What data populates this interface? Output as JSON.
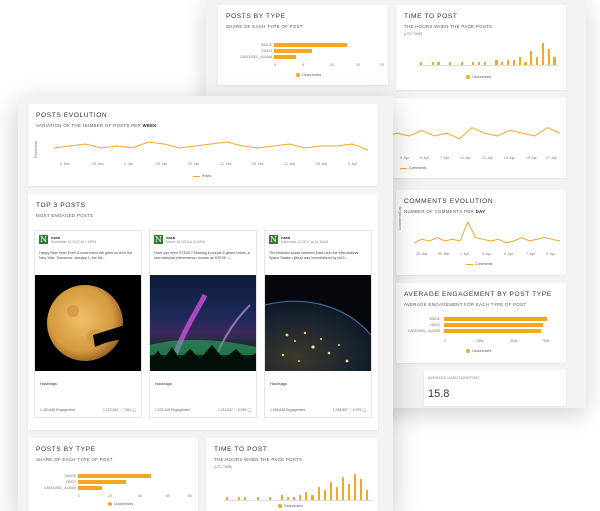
{
  "colors": {
    "accent": "#f5a623",
    "brand_green": "#2e7d32"
  },
  "back": {
    "posts_by_type": {
      "title": "POSTS BY TYPE",
      "subtitle": "SHARE OF EACH TYPE OF POST",
      "categories": [
        "IMAGE",
        "VIDEO",
        "CAROUSEL_ALBUM"
      ],
      "values": [
        13.5,
        7,
        4
      ],
      "ticks": [
        "0",
        "5",
        "10",
        "15",
        "20"
      ],
      "legend": "Occurences"
    },
    "time_to_post": {
      "title": "TIME TO POST",
      "subtitle": "THE HOURS WHEN THE PAGE POSTS",
      "unit": "(UTC TIME)",
      "legend": "Occurences"
    },
    "dates_row": [
      "5. Apr",
      "6. Apr",
      "7. Apr",
      "10. Apr",
      "12. Apr",
      "13. Apr",
      "15. Apr",
      "17. Apr"
    ],
    "comments_legend": "Comments",
    "comments_evolution": {
      "title": "COMMENTS EVOLUTION",
      "subtitle_pre": "NUMBER OF COMMENTS PER",
      "subtitle_bold": "DAY",
      "ylabel": "Comments/Day",
      "x_ticks": [
        "28. Mar",
        "30. Mar",
        "1. Apr",
        "3. Apr",
        "5. Apr",
        "7. Apr",
        "9. Apr"
      ],
      "legend": "Comments"
    },
    "avg_engagement": {
      "title": "AVERAGE ENGAGEMENT BY POST TYPE",
      "subtitle": "AVERAGE ENGAGEMENT FOR EACH TYPE OF POST",
      "categories": [
        "IMAGE",
        "VIDEO",
        "CAROUSEL_ALBUM"
      ],
      "values": [
        950,
        920,
        900
      ],
      "ticks": [
        "0",
        "250k",
        "500k",
        "750k"
      ],
      "legend": "Occurences"
    },
    "avg_hashtags": {
      "label": "AVERAGE HASHTAGS/POST",
      "value": "15.8"
    }
  },
  "front": {
    "posts_evolution": {
      "title": "POSTS EVOLUTION",
      "subtitle_pre": "VARIATION OF THE NUMBER OF POSTS PER",
      "subtitle_bold": "WEEK",
      "ylabel": "Posts/week",
      "x_ticks": [
        "4. Dec",
        "18. Dec",
        "1. Jan",
        "15. Jan",
        "29. Jan",
        "12. Feb",
        "26. Feb",
        "12. Mar",
        "26. Mar",
        "9. Apr"
      ],
      "legend": "Posts"
    },
    "top_posts": {
      "title": "TOP 3 POSTS",
      "subtitle": "MOST ENGAGED POSTS",
      "posts": [
        {
          "account": "nasa",
          "date": "December 31 2017 at 7:19PM",
          "text": "Happy New Year! Ever! A lunar event will greet us all in the New Year: Tomorrow, January 1, the full...",
          "tags": "Hashtags",
          "engagement": "1,490,658 Engagement",
          "stats": "1,270,162 ♡  7,811 ◯"
        },
        {
          "account": "nasa",
          "date": "March 28 2018 at 3:24PM",
          "text": "Have you seen STEVE? Glowing in purple & green colors, a new celestial phenomenon, known as STEVE, i...",
          "tags": "Hashtags",
          "engagement": "1,223,108 Engagement",
          "stats": "1,211,037 ♡  6,099 ◯"
        },
        {
          "account": "nasa",
          "date": "December 21 2017 at 10:30AM",
          "text": "The beautiful space between Earth and the International Space Station (@iss) was immortalized by NAS...",
          "tags": "Hashtags",
          "engagement": "1,058,836 Engagement",
          "stats": "1,053,857 ♡  4,979 ◯"
        }
      ]
    },
    "posts_by_type": {
      "title": "POSTS BY TYPE",
      "subtitle": "SHARE OF EACH TYPE OF POST",
      "categories": [
        "IMAGE",
        "VIDEO",
        "CAROUSEL_ALBUM"
      ],
      "values": [
        52,
        34,
        17
      ],
      "ticks": [
        "0",
        "20",
        "40",
        "60",
        "80"
      ],
      "legend": "Occurences"
    },
    "time_to_post": {
      "title": "TIME TO POST",
      "subtitle": "THE HOURS WHEN THE PAGE POSTS",
      "unit": "(UTC TIME)",
      "legend": "Occurences"
    }
  },
  "chart_data": [
    {
      "type": "bar",
      "title": "POSTS BY TYPE",
      "categories": [
        "IMAGE",
        "VIDEO",
        "CAROUSEL_ALBUM"
      ],
      "values": [
        13.5,
        7,
        4
      ],
      "xlim": [
        0,
        20
      ]
    },
    {
      "type": "bar",
      "title": "TIME TO POST",
      "categories": [
        "0",
        "1",
        "2",
        "3",
        "4",
        "5",
        "6",
        "7",
        "8",
        "9",
        "10",
        "11",
        "12",
        "13",
        "14",
        "15",
        "16",
        "17",
        "18",
        "19",
        "20",
        "21",
        "22",
        "23"
      ],
      "values": [
        1,
        0,
        1,
        1,
        0,
        1,
        0,
        1,
        0,
        1,
        1,
        1,
        0,
        2,
        1,
        2,
        2,
        3,
        1,
        5,
        3,
        8,
        6,
        3
      ]
    },
    {
      "type": "line",
      "title": "POSTS EVOLUTION",
      "x": [
        "4. Dec",
        "18. Dec",
        "1. Jan",
        "15. Jan",
        "29. Jan",
        "12. Feb",
        "26. Feb",
        "12. Mar",
        "26. Mar",
        "9. Apr"
      ],
      "values": [
        5,
        6,
        7,
        5,
        6,
        5,
        8,
        7,
        5,
        6,
        7,
        8,
        6,
        5,
        6,
        7,
        5,
        6,
        6,
        7,
        4
      ]
    },
    {
      "type": "line",
      "title": "COMMENTS EVOLUTION",
      "x": [
        "28. Mar",
        "30. Mar",
        "1. Apr",
        "3. Apr",
        "5. Apr",
        "7. Apr",
        "9. Apr"
      ],
      "values": [
        3,
        5,
        4,
        6,
        4,
        5,
        4,
        15,
        6,
        5,
        4,
        5,
        3,
        4,
        6,
        4,
        5,
        6,
        5,
        4
      ]
    },
    {
      "type": "bar",
      "title": "AVERAGE ENGAGEMENT BY POST TYPE",
      "categories": [
        "IMAGE",
        "VIDEO",
        "CAROUSEL_ALBUM"
      ],
      "values": [
        950,
        920,
        900
      ]
    },
    {
      "type": "bar",
      "title": "POSTS BY TYPE",
      "categories": [
        "IMAGE",
        "VIDEO",
        "CAROUSEL_ALBUM"
      ],
      "values": [
        52,
        34,
        17
      ],
      "xlim": [
        0,
        80
      ]
    },
    {
      "type": "bar",
      "title": "TIME TO POST",
      "categories": [
        "0",
        "1",
        "2",
        "3",
        "4",
        "5",
        "6",
        "7",
        "8",
        "9",
        "10",
        "11",
        "12",
        "13",
        "14",
        "15",
        "16",
        "17",
        "18",
        "19",
        "20",
        "21",
        "22",
        "23"
      ],
      "values": [
        1,
        0,
        1,
        1,
        0,
        1,
        0,
        1,
        0,
        2,
        1,
        1,
        2,
        3,
        2,
        5,
        4,
        7,
        5,
        9,
        6,
        10,
        8,
        4
      ]
    }
  ]
}
